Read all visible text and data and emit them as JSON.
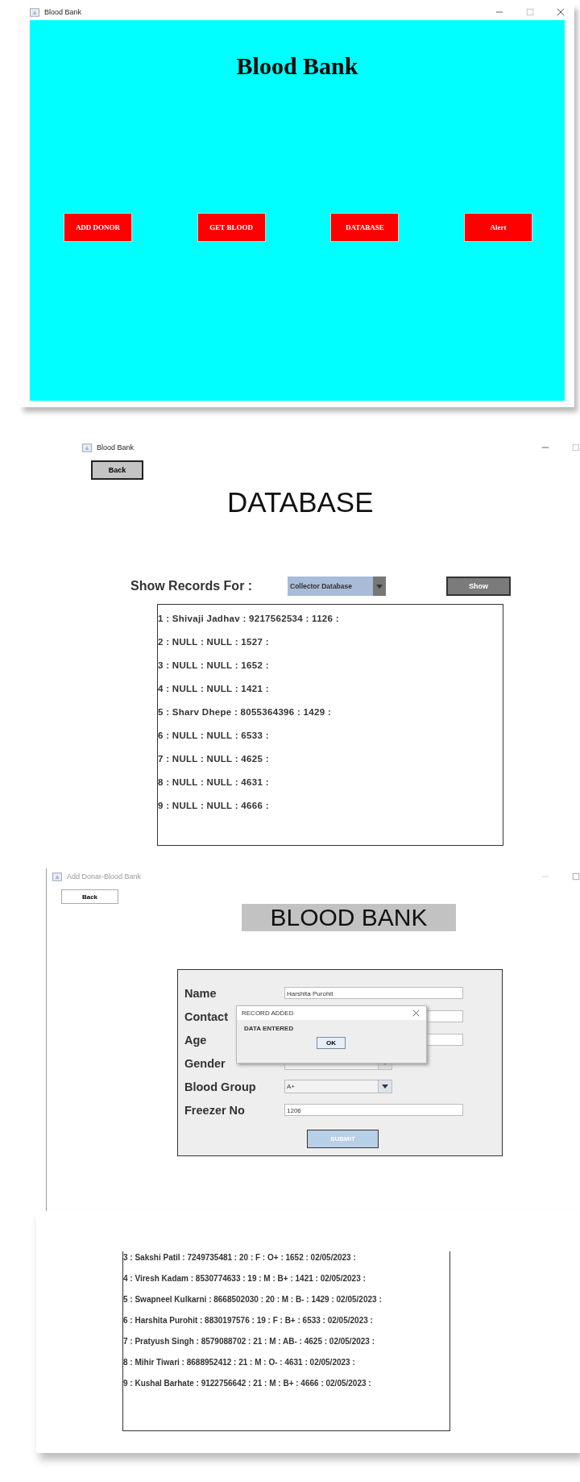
{
  "home_window": {
    "title": "Blood Bank",
    "heading": "Blood Bank",
    "buttons": [
      "ADD DONOR",
      "GET BLOOD",
      "DATABASE",
      "Alert"
    ]
  },
  "database_window": {
    "title": "Blood Bank",
    "back_button": "Back",
    "heading": "DATABASE",
    "filter_label": "Show Records For :",
    "filter_value": "Collector Database",
    "show_button": "Show",
    "records": [
      "1 : Shivaji Jadhav : 9217562534 : 1126 :",
      "2 : NULL : NULL : 1527 :",
      "3 : NULL : NULL : 1652 :",
      "4 : NULL : NULL : 1421 :",
      "5 : Sharv Dhepe : 8055364396 : 1429 :",
      "6 : NULL : NULL : 6533 :",
      "7 : NULL : NULL : 4625 :",
      "8 : NULL : NULL : 4631 :",
      "9 : NULL : NULL : 4666 :"
    ]
  },
  "add_donor_window": {
    "title": "Add Donar-Blood Bank",
    "back_button": "Back",
    "heading": "BLOOD BANK",
    "fields": [
      {
        "label": "Name",
        "kind": "text",
        "value": "Harshita Purohit"
      },
      {
        "label": "Contact",
        "kind": "text"
      },
      {
        "label": "Age",
        "kind": "text"
      },
      {
        "label": "Gender",
        "kind": "dropdown"
      },
      {
        "label": "Blood Group",
        "kind": "dropdown",
        "value": "A+"
      },
      {
        "label": "Freezer No",
        "kind": "text",
        "value": "1206"
      }
    ],
    "submit_button": "SUBMIT",
    "dialog": {
      "title": "RECORD ADDED",
      "message": "DATA ENTERED",
      "button": "OK"
    }
  },
  "donor_records_window": {
    "records": [
      "3 : Sakshi Patil : 7249735481 : 20 : F : O+ : 1652 : 02/05/2023 :",
      "4 : Viresh Kadam : 8530774633 : 19 : M : B+ : 1421 : 02/05/2023 :",
      "5 : Swapneel Kulkarni : 8668502030 : 20 : M : B- : 1429 : 02/05/2023 :",
      "6 : Harshita Purohit : 8830197576 : 19 : F : B+ : 6533 : 02/05/2023 :",
      "7 : Pratyush Singh : 8579088702 : 21 : M : AB- : 4625 : 02/05/2023 :",
      "8 : Mihir Tiwari : 8688952412 : 21 : M : O- : 4631 : 02/05/2023 :",
      "9 : Kushal Barhate : 9122756642 : 21 : M : B+ : 4666 : 02/05/2023 :"
    ]
  }
}
